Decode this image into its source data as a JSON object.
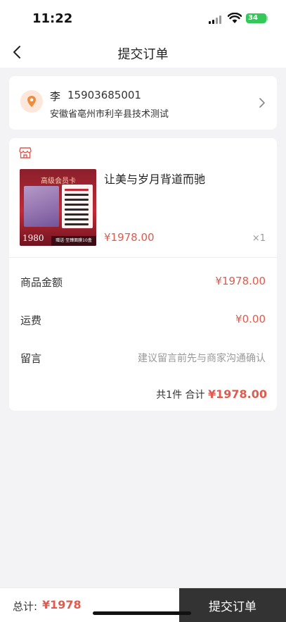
{
  "status_bar": {
    "time": "11:22",
    "battery": "34"
  },
  "nav": {
    "title": "提交订单"
  },
  "address": {
    "name": "李",
    "phone": "15903685001",
    "detail": "安徽省亳州市利辛县技术测试"
  },
  "product": {
    "title": "让美与岁月背道而驰",
    "price": "¥1978.00",
    "qty": "×1",
    "image_alt": "高级会员卡商品图"
  },
  "rows": {
    "goods_label": "商品金额",
    "goods_value": "¥1978.00",
    "shipping_label": "运费",
    "shipping_value": "¥0.00",
    "note_label": "留言",
    "note_placeholder": "建议留言前先与商家沟通确认"
  },
  "summary": {
    "count": "共1件",
    "label": "合计",
    "amount": "¥1978.00"
  },
  "bottom": {
    "total_label": "总计:",
    "total_value": "¥1978",
    "submit_label": "提交订单"
  },
  "colors": {
    "accent": "#e05a4e",
    "submit_bg": "#333333",
    "page_bg": "#f3f3f5"
  }
}
